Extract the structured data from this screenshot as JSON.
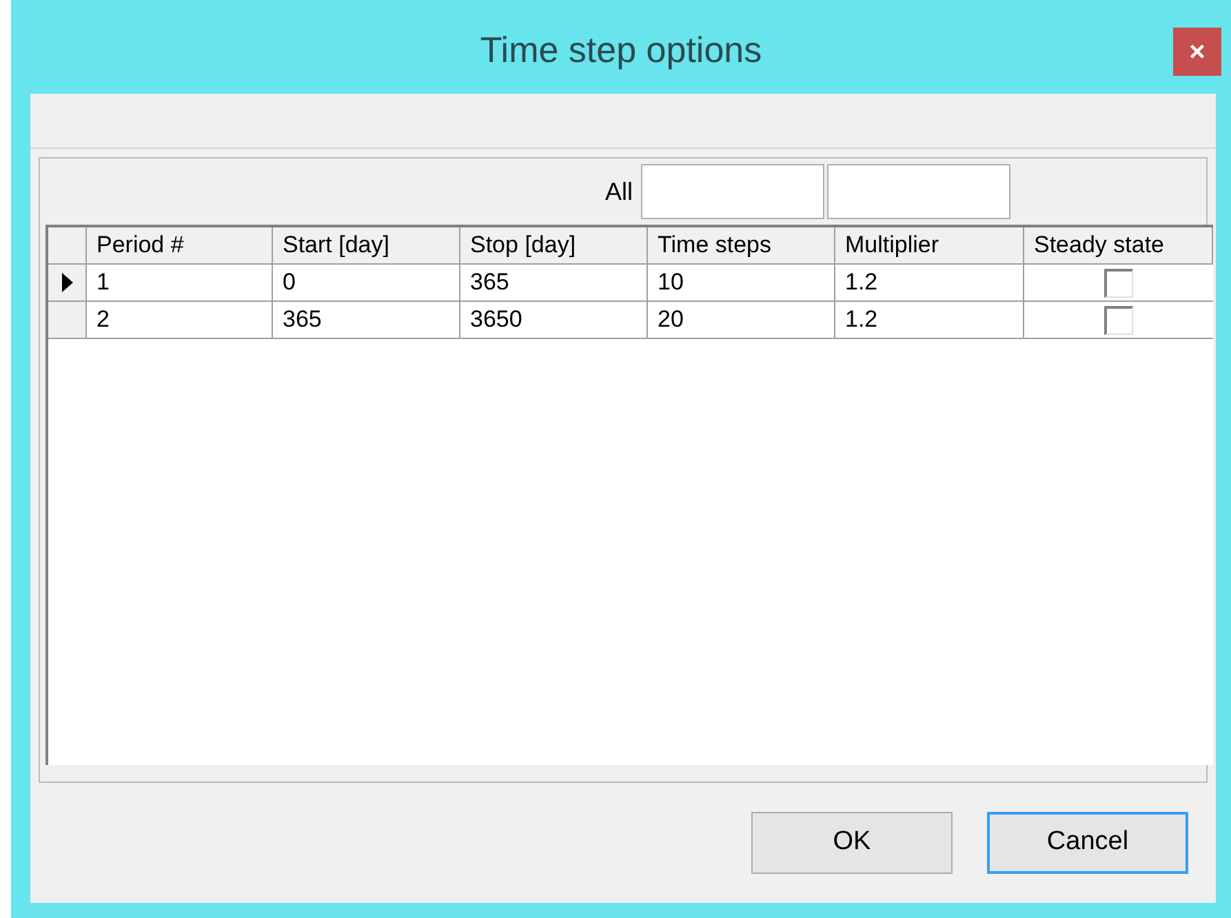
{
  "window": {
    "title": "Time step options",
    "close": "×"
  },
  "all_row": {
    "label": "All",
    "fields": [
      {
        "kind": "input"
      },
      {
        "kind": "input"
      }
    ]
  },
  "table": {
    "columns": [
      "Period #",
      "Start [day]",
      "Stop [day]",
      "Time steps",
      "Multiplier",
      "Steady state"
    ],
    "rows": [
      {
        "current": true,
        "cells": [
          "1",
          "0",
          "365",
          "10",
          "1.2"
        ],
        "steady_state": false
      },
      {
        "current": false,
        "cells": [
          "2",
          "365",
          "3650",
          "20",
          "1.2"
        ],
        "steady_state": false
      }
    ]
  },
  "buttons": [
    {
      "label": "OK",
      "focused": false
    },
    {
      "label": "Cancel",
      "focused": true
    }
  ]
}
